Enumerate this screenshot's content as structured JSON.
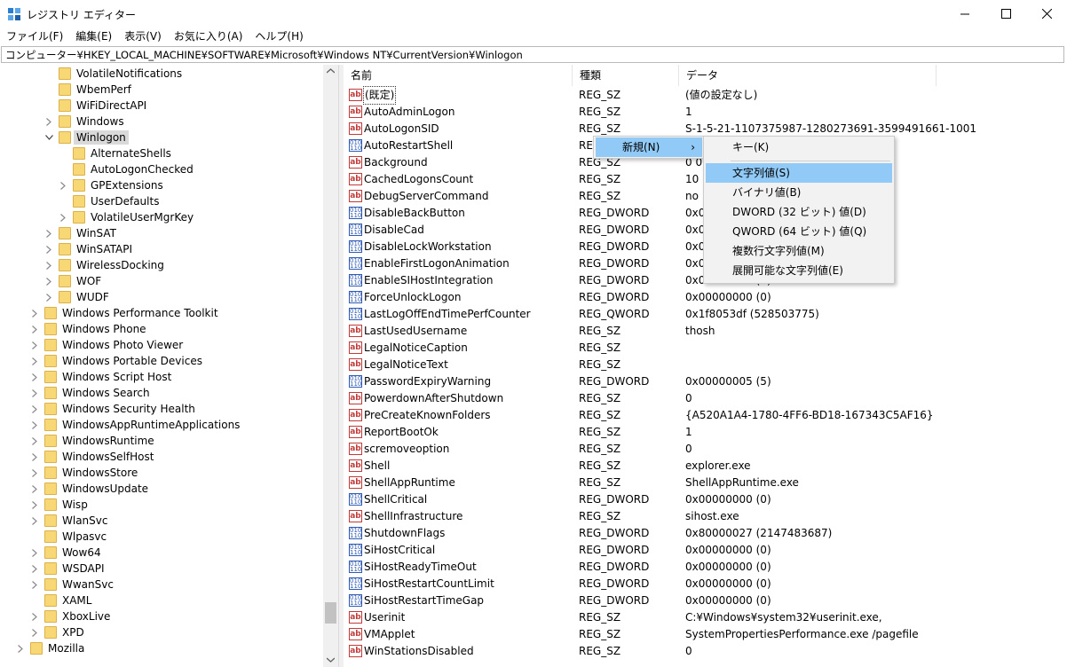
{
  "window": {
    "title": "レジストリ エディター",
    "controls": {
      "minimize": "—",
      "maximize": "☐",
      "close": "✕"
    }
  },
  "menubar": [
    "ファイル(F)",
    "編集(E)",
    "表示(V)",
    "お気に入り(A)",
    "ヘルプ(H)"
  ],
  "address": "コンピューター¥HKEY_LOCAL_MACHINE¥SOFTWARE¥Microsoft¥Windows NT¥CurrentVersion¥Winlogon",
  "tree": [
    {
      "label": "VolatileNotifications",
      "level": 2,
      "chevron": "none"
    },
    {
      "label": "WbemPerf",
      "level": 2,
      "chevron": "none"
    },
    {
      "label": "WiFiDirectAPI",
      "level": 2,
      "chevron": "none"
    },
    {
      "label": "Windows",
      "level": 2,
      "chevron": "collapsed"
    },
    {
      "label": "Winlogon",
      "level": 2,
      "chevron": "expanded",
      "selected": true
    },
    {
      "label": "AlternateShells",
      "level": 3,
      "chevron": "none"
    },
    {
      "label": "AutoLogonChecked",
      "level": 3,
      "chevron": "none"
    },
    {
      "label": "GPExtensions",
      "level": 3,
      "chevron": "collapsed"
    },
    {
      "label": "UserDefaults",
      "level": 3,
      "chevron": "none"
    },
    {
      "label": "VolatileUserMgrKey",
      "level": 3,
      "chevron": "collapsed"
    },
    {
      "label": "WinSAT",
      "level": 2,
      "chevron": "collapsed"
    },
    {
      "label": "WinSATAPI",
      "level": 2,
      "chevron": "collapsed"
    },
    {
      "label": "WirelessDocking",
      "level": 2,
      "chevron": "collapsed"
    },
    {
      "label": "WOF",
      "level": 2,
      "chevron": "collapsed"
    },
    {
      "label": "WUDF",
      "level": 2,
      "chevron": "collapsed"
    },
    {
      "label": "Windows Performance Toolkit",
      "level": 1,
      "chevron": "collapsed"
    },
    {
      "label": "Windows Phone",
      "level": 1,
      "chevron": "collapsed"
    },
    {
      "label": "Windows Photo Viewer",
      "level": 1,
      "chevron": "collapsed"
    },
    {
      "label": "Windows Portable Devices",
      "level": 1,
      "chevron": "collapsed"
    },
    {
      "label": "Windows Script Host",
      "level": 1,
      "chevron": "collapsed"
    },
    {
      "label": "Windows Search",
      "level": 1,
      "chevron": "collapsed"
    },
    {
      "label": "Windows Security Health",
      "level": 1,
      "chevron": "collapsed"
    },
    {
      "label": "WindowsAppRuntimeApplications",
      "level": 1,
      "chevron": "collapsed"
    },
    {
      "label": "WindowsRuntime",
      "level": 1,
      "chevron": "collapsed"
    },
    {
      "label": "WindowsSelfHost",
      "level": 1,
      "chevron": "collapsed"
    },
    {
      "label": "WindowsStore",
      "level": 1,
      "chevron": "collapsed"
    },
    {
      "label": "WindowsUpdate",
      "level": 1,
      "chevron": "collapsed"
    },
    {
      "label": "Wisp",
      "level": 1,
      "chevron": "collapsed"
    },
    {
      "label": "WlanSvc",
      "level": 1,
      "chevron": "collapsed"
    },
    {
      "label": "Wlpasvc",
      "level": 1,
      "chevron": "none"
    },
    {
      "label": "Wow64",
      "level": 1,
      "chevron": "collapsed"
    },
    {
      "label": "WSDAPI",
      "level": 1,
      "chevron": "collapsed"
    },
    {
      "label": "WwanSvc",
      "level": 1,
      "chevron": "collapsed"
    },
    {
      "label": "XAML",
      "level": 1,
      "chevron": "none"
    },
    {
      "label": "XboxLive",
      "level": 1,
      "chevron": "collapsed"
    },
    {
      "label": "XPD",
      "level": 1,
      "chevron": "collapsed"
    },
    {
      "label": "Mozilla",
      "level": 0,
      "chevron": "collapsed"
    }
  ],
  "list": {
    "headers": [
      "名前",
      "種類",
      "データ"
    ],
    "rows": [
      {
        "name": "(既定)",
        "type": "REG_SZ",
        "data": "(値の設定なし)",
        "icon": "ab"
      },
      {
        "name": "AutoAdminLogon",
        "type": "REG_SZ",
        "data": "1",
        "icon": "ab"
      },
      {
        "name": "AutoLogonSID",
        "type": "REG_SZ",
        "data": "S-1-5-21-1107375987-1280273691-3599491661-1001",
        "icon": "ab"
      },
      {
        "name": "AutoRestartShell",
        "type": "RE",
        "data": "",
        "icon": "bin"
      },
      {
        "name": "Background",
        "type": "REG_SZ",
        "data": "0 0",
        "icon": "ab"
      },
      {
        "name": "CachedLogonsCount",
        "type": "REG_SZ",
        "data": "10",
        "icon": "ab"
      },
      {
        "name": "DebugServerCommand",
        "type": "REG_SZ",
        "data": "no",
        "icon": "ab"
      },
      {
        "name": "DisableBackButton",
        "type": "REG_DWORD",
        "data": "0x0",
        "icon": "bin"
      },
      {
        "name": "DisableCad",
        "type": "REG_DWORD",
        "data": "0x0",
        "icon": "bin"
      },
      {
        "name": "DisableLockWorkstation",
        "type": "REG_DWORD",
        "data": "0x0",
        "icon": "bin"
      },
      {
        "name": "EnableFirstLogonAnimation",
        "type": "REG_DWORD",
        "data": "0x0",
        "icon": "bin"
      },
      {
        "name": "EnableSIHostIntegration",
        "type": "REG_DWORD",
        "data": "0x00000001 (1)",
        "icon": "bin"
      },
      {
        "name": "ForceUnlockLogon",
        "type": "REG_DWORD",
        "data": "0x00000000 (0)",
        "icon": "bin"
      },
      {
        "name": "LastLogOffEndTimePerfCounter",
        "type": "REG_QWORD",
        "data": "0x1f8053df (528503775)",
        "icon": "bin"
      },
      {
        "name": "LastUsedUsername",
        "type": "REG_SZ",
        "data": "thosh",
        "icon": "ab"
      },
      {
        "name": "LegalNoticeCaption",
        "type": "REG_SZ",
        "data": "",
        "icon": "ab"
      },
      {
        "name": "LegalNoticeText",
        "type": "REG_SZ",
        "data": "",
        "icon": "ab"
      },
      {
        "name": "PasswordExpiryWarning",
        "type": "REG_DWORD",
        "data": "0x00000005 (5)",
        "icon": "bin"
      },
      {
        "name": "PowerdownAfterShutdown",
        "type": "REG_SZ",
        "data": "0",
        "icon": "ab"
      },
      {
        "name": "PreCreateKnownFolders",
        "type": "REG_SZ",
        "data": "{A520A1A4-1780-4FF6-BD18-167343C5AF16}",
        "icon": "ab"
      },
      {
        "name": "ReportBootOk",
        "type": "REG_SZ",
        "data": "1",
        "icon": "ab"
      },
      {
        "name": "scremoveoption",
        "type": "REG_SZ",
        "data": "0",
        "icon": "ab"
      },
      {
        "name": "Shell",
        "type": "REG_SZ",
        "data": "explorer.exe",
        "icon": "ab"
      },
      {
        "name": "ShellAppRuntime",
        "type": "REG_SZ",
        "data": "ShellAppRuntime.exe",
        "icon": "ab"
      },
      {
        "name": "ShellCritical",
        "type": "REG_DWORD",
        "data": "0x00000000 (0)",
        "icon": "bin"
      },
      {
        "name": "ShellInfrastructure",
        "type": "REG_SZ",
        "data": "sihost.exe",
        "icon": "ab"
      },
      {
        "name": "ShutdownFlags",
        "type": "REG_DWORD",
        "data": "0x80000027 (2147483687)",
        "icon": "bin"
      },
      {
        "name": "SiHostCritical",
        "type": "REG_DWORD",
        "data": "0x00000000 (0)",
        "icon": "bin"
      },
      {
        "name": "SiHostReadyTimeOut",
        "type": "REG_DWORD",
        "data": "0x00000000 (0)",
        "icon": "bin"
      },
      {
        "name": "SiHostRestartCountLimit",
        "type": "REG_DWORD",
        "data": "0x00000000 (0)",
        "icon": "bin"
      },
      {
        "name": "SiHostRestartTimeGap",
        "type": "REG_DWORD",
        "data": "0x00000000 (0)",
        "icon": "bin"
      },
      {
        "name": "Userinit",
        "type": "REG_SZ",
        "data": "C:¥Windows¥system32¥userinit.exe,",
        "icon": "ab"
      },
      {
        "name": "VMApplet",
        "type": "REG_SZ",
        "data": "SystemPropertiesPerformance.exe /pagefile",
        "icon": "ab"
      },
      {
        "name": "WinStationsDisabled",
        "type": "REG_SZ",
        "data": "0",
        "icon": "ab"
      }
    ]
  },
  "context_menu": {
    "item": "新規(N)",
    "arrow": "›"
  },
  "submenu": {
    "items": [
      "キー(K)",
      "文字列値(S)",
      "バイナリ値(B)",
      "DWORD (32 ビット) 値(D)",
      "QWORD (64 ビット) 値(Q)",
      "複数行文字列値(M)",
      "展開可能な文字列値(E)"
    ],
    "highlighted": "文字列値(S)"
  },
  "icons": {
    "app": "registry-editor-icon",
    "string_value": "ab",
    "binary_value": "010 110"
  },
  "colors": {
    "selection": "#91c9f7",
    "tree_selected": "#d9d9d9",
    "folder": "#f8d775"
  }
}
